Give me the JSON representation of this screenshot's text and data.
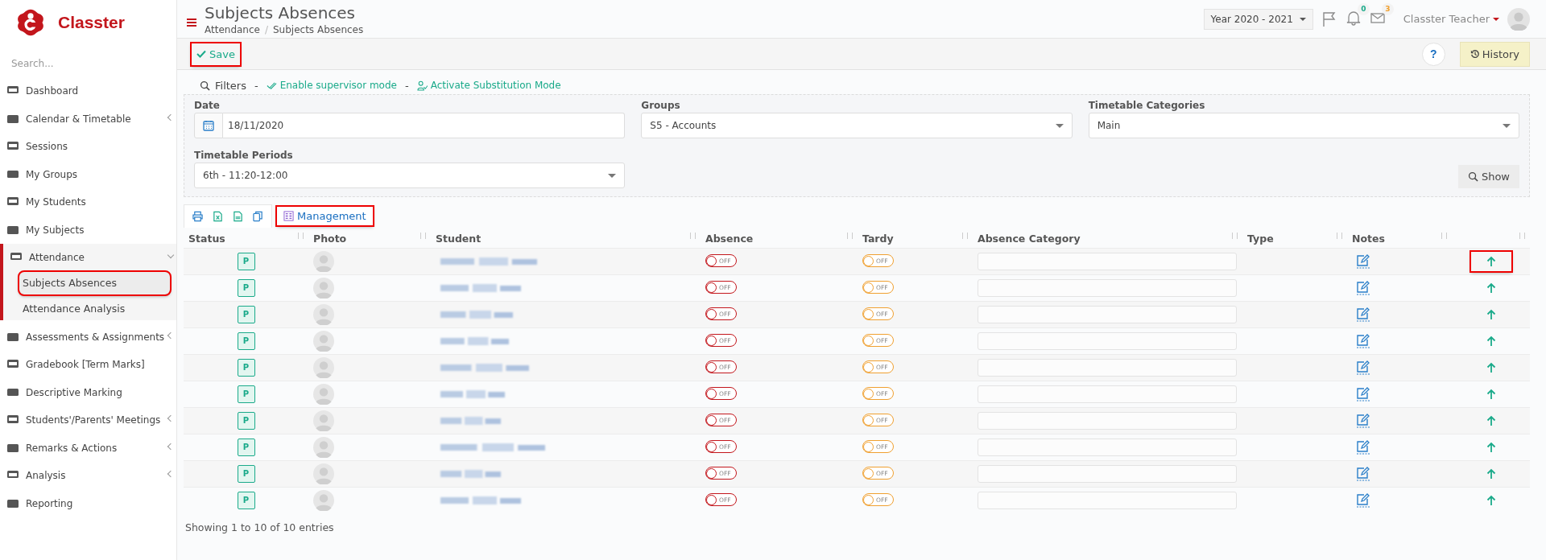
{
  "brand": {
    "name": "Classter"
  },
  "sidebar": {
    "search": {
      "placeholder": "Search..."
    },
    "items": [
      {
        "label": "Dashboard"
      },
      {
        "label": "Calendar & Timetable",
        "expanded": false
      },
      {
        "label": "Sessions"
      },
      {
        "label": "My Groups"
      },
      {
        "label": "My Students"
      },
      {
        "label": "My Subjects"
      },
      {
        "label": "Attendance",
        "expanded": true,
        "children": [
          {
            "label": "Subjects Absences",
            "selected": true,
            "highlighted": true
          },
          {
            "label": "Attendance Analysis",
            "selected": false,
            "highlighted": false
          }
        ]
      },
      {
        "label": "Assessments & Assignments",
        "expanded": false
      },
      {
        "label": "Gradebook [Term Marks]"
      },
      {
        "label": "Descriptive Marking"
      },
      {
        "label": "Students'/Parents' Meetings",
        "expanded": false
      },
      {
        "label": "Remarks & Actions",
        "expanded": false
      },
      {
        "label": "Analysis",
        "expanded": false
      },
      {
        "label": "Reporting"
      }
    ]
  },
  "header": {
    "title": "Subjects Absences",
    "breadcrumb": [
      {
        "text": "Attendance",
        "kind": "link"
      },
      {
        "text": "/",
        "kind": "separator"
      },
      {
        "text": "Subjects Absences",
        "kind": "current"
      }
    ],
    "year": "Year 2020 - 2021",
    "notifications": "0",
    "messages": "3",
    "user": "Classter Teacher"
  },
  "toolbar": {
    "save": {
      "label": "Save",
      "highlighted": true
    },
    "help": "?",
    "history": "History"
  },
  "filters": {
    "title": "Filters",
    "links": [
      {
        "separator": "-",
        "label": "Enable supervisor mode"
      },
      {
        "separator": "-",
        "label": "Activate Substitution Mode"
      }
    ],
    "fields": [
      {
        "label": "Date",
        "value": "18/11/2020",
        "kind": "date"
      },
      {
        "label": "Groups",
        "value": "S5 - Accounts",
        "kind": "select"
      },
      {
        "label": "Timetable Categories",
        "value": "Main",
        "kind": "select"
      },
      {
        "label": "Timetable Periods",
        "value": "6th - 11:20-12:00",
        "kind": "select"
      }
    ],
    "show": "Show"
  },
  "table": {
    "management": {
      "label": "Management",
      "highlighted": true
    },
    "columns": [
      "Status",
      "Photo",
      "Student",
      "Absence",
      "Tardy",
      "Absence Category",
      "Type",
      "Notes"
    ],
    "rows": [
      {
        "status": "P",
        "absence": false,
        "absence_label": "OFF",
        "tardy": false,
        "tardy_label": "OFF",
        "highlighted": true
      },
      {
        "status": "P",
        "absence": false,
        "absence_label": "OFF",
        "tardy": false,
        "tardy_label": "OFF",
        "highlighted": false
      },
      {
        "status": "P",
        "absence": false,
        "absence_label": "OFF",
        "tardy": false,
        "tardy_label": "OFF",
        "highlighted": false
      },
      {
        "status": "P",
        "absence": false,
        "absence_label": "OFF",
        "tardy": false,
        "tardy_label": "OFF",
        "highlighted": false
      },
      {
        "status": "P",
        "absence": false,
        "absence_label": "OFF",
        "tardy": false,
        "tardy_label": "OFF",
        "highlighted": false
      },
      {
        "status": "P",
        "absence": false,
        "absence_label": "OFF",
        "tardy": false,
        "tardy_label": "OFF",
        "highlighted": false
      },
      {
        "status": "P",
        "absence": false,
        "absence_label": "OFF",
        "tardy": false,
        "tardy_label": "OFF",
        "highlighted": false
      },
      {
        "status": "P",
        "absence": false,
        "absence_label": "OFF",
        "tardy": false,
        "tardy_label": "OFF",
        "highlighted": false
      },
      {
        "status": "P",
        "absence": false,
        "absence_label": "OFF",
        "tardy": false,
        "tardy_label": "OFF",
        "highlighted": false
      },
      {
        "status": "P",
        "absence": false,
        "absence_label": "OFF",
        "tardy": false,
        "tardy_label": "OFF",
        "highlighted": false
      }
    ],
    "footer": "Showing 1 to 10 of 10 entries"
  }
}
